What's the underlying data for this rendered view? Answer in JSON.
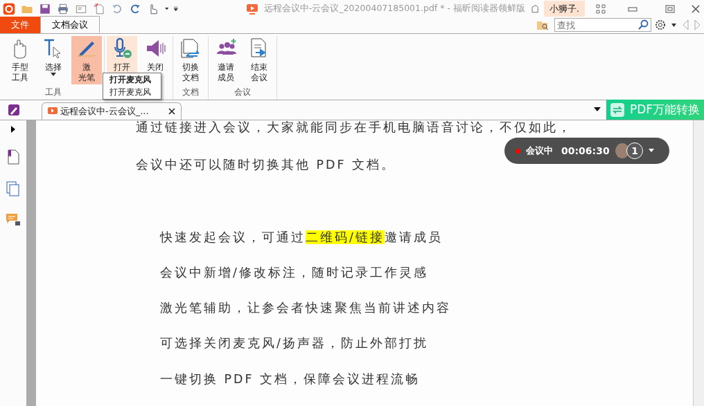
{
  "window": {
    "title": "远程会议中-云会议_20200407185001.pdf * - 福昕阅读器领鲜版",
    "user": "小狮子."
  },
  "menu_tabs": [
    {
      "label": "文件",
      "kind": "file",
      "selected": false
    },
    {
      "label": "文档会议",
      "kind": "tab",
      "selected": true
    }
  ],
  "search": {
    "placeholder": "查找"
  },
  "ribbon_groups": [
    {
      "label": "工具",
      "buttons": [
        {
          "kind": "hand",
          "lines": [
            "手型",
            "工具"
          ],
          "selected": false,
          "hovered": false,
          "dropdown": false
        },
        {
          "kind": "select",
          "lines": [
            "选择"
          ],
          "selected": false,
          "hovered": false,
          "dropdown": true
        },
        {
          "kind": "laser",
          "lines": [
            "激",
            "光笔"
          ],
          "selected": true,
          "hovered": false,
          "dropdown": false
        }
      ]
    },
    {
      "buttons": [
        {
          "kind": "mic",
          "lines": [
            "打开"
          ],
          "selected": false,
          "hovered": true,
          "dropdown": false
        },
        {
          "kind": "speaker",
          "lines": [
            "关闭"
          ],
          "selected": false,
          "hovered": false,
          "dropdown": false
        }
      ]
    },
    {
      "label": "文档",
      "buttons": [
        {
          "kind": "switch",
          "lines": [
            "切换",
            "文档"
          ],
          "selected": false,
          "hovered": false,
          "dropdown": false
        }
      ]
    },
    {
      "label": "会议",
      "buttons": [
        {
          "kind": "invite",
          "lines": [
            "邀请",
            "成员"
          ],
          "selected": false,
          "hovered": false,
          "dropdown": false
        },
        {
          "kind": "end",
          "lines": [
            "结束",
            "会议"
          ],
          "selected": false,
          "hovered": false,
          "dropdown": false
        }
      ]
    }
  ],
  "tooltip": {
    "title": "打开麦克风",
    "text": "打开麦克风"
  },
  "document_tab": {
    "label": "远程会议中-云会议_..."
  },
  "banner": {
    "label": "PDF万能转换"
  },
  "meeting": {
    "status": "会议中",
    "time": "00:06:30",
    "participants": "1"
  },
  "paragraphs": [
    {
      "text": "通过链接进入会议，大家就能同步在手机电脑语音讨论，不仅如此，"
    },
    {
      "text": "会议中还可以随时切换其他 PDF 文档。"
    }
  ],
  "features": [
    {
      "segments": [
        {
          "text": "快速发起会议，可通过",
          "highlighted": false
        },
        {
          "text": "二维码/链接",
          "highlighted": true
        },
        {
          "text": "邀请成员",
          "highlighted": false
        }
      ]
    },
    {
      "segments": [
        {
          "text": "会议中新增/修改标注，随时记录工作灵感",
          "highlighted": false
        }
      ]
    },
    {
      "segments": [
        {
          "text": "激光笔辅助，让参会者快速聚焦当前讲述内容",
          "highlighted": false
        }
      ]
    },
    {
      "segments": [
        {
          "text": "可选择关闭麦克风/扬声器，防止外部打扰",
          "highlighted": false
        }
      ]
    },
    {
      "segments": [
        {
          "text": "一键切换 PDF 文档，保障会议进程流畅",
          "highlighted": false
        }
      ]
    }
  ]
}
